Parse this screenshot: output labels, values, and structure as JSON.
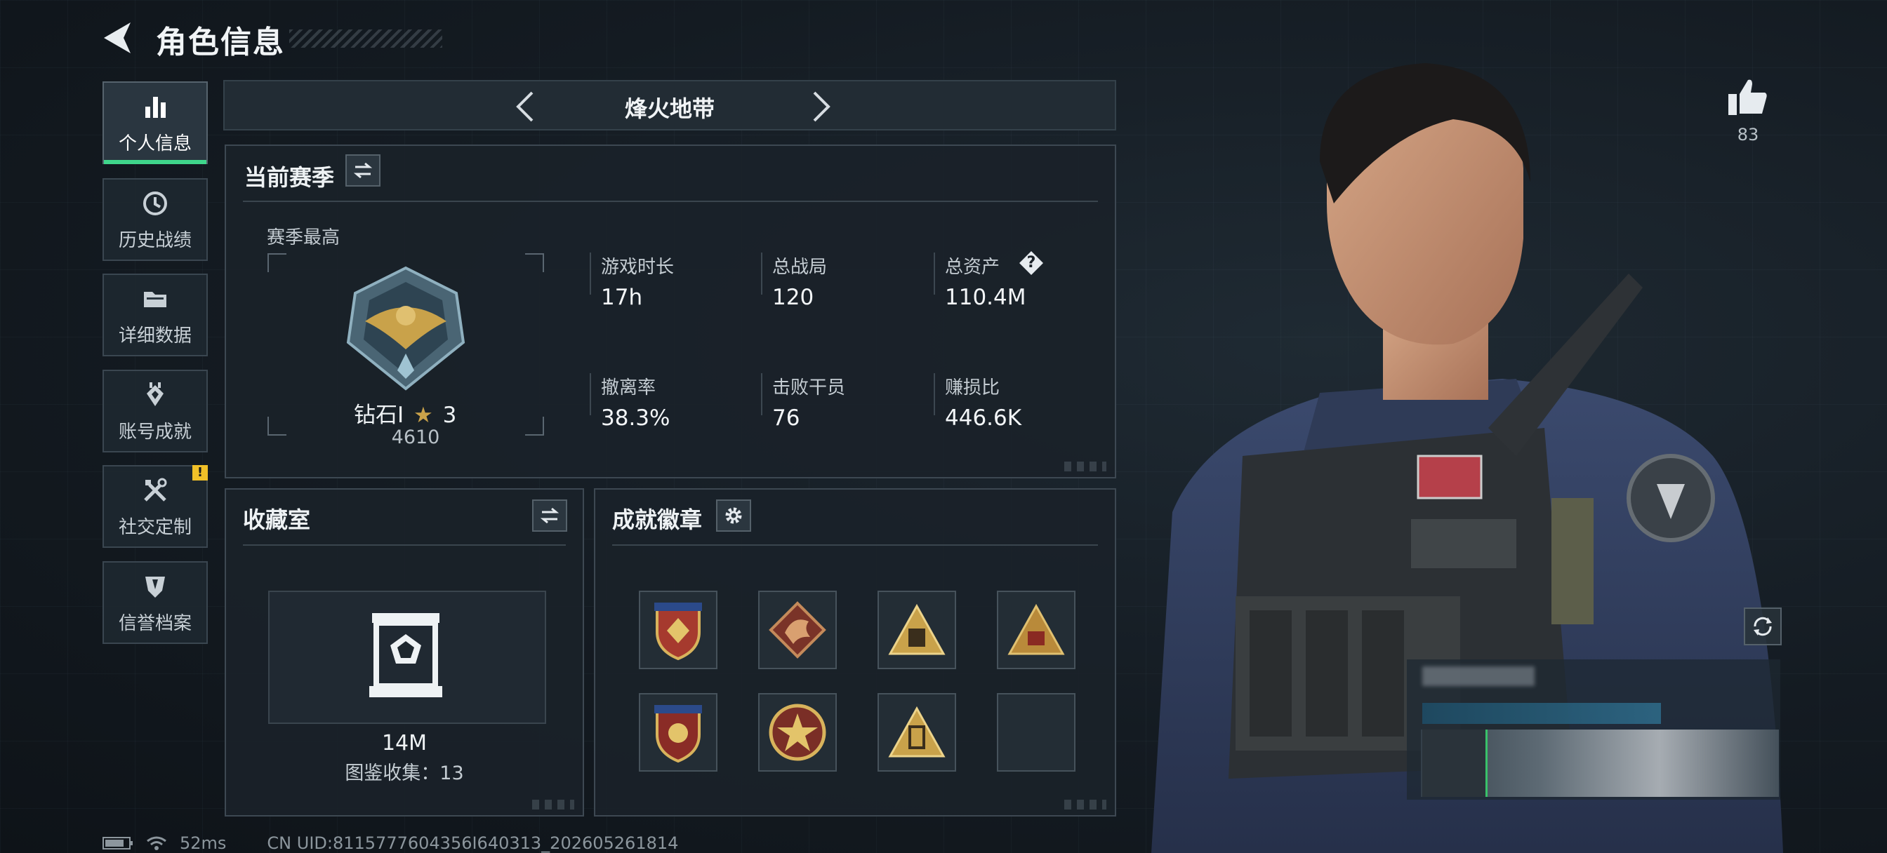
{
  "header": {
    "title": "角色信息"
  },
  "nav": {
    "items": [
      {
        "label": "个人信息",
        "icon": "bar-chart-icon",
        "active": true
      },
      {
        "label": "历史战绩",
        "icon": "history-icon"
      },
      {
        "label": "详细数据",
        "icon": "folder-icon"
      },
      {
        "label": "账号成就",
        "icon": "achievement-icon"
      },
      {
        "label": "社交定制",
        "icon": "tools-icon",
        "badge": "!"
      },
      {
        "label": "信誉档案",
        "icon": "shield-icon"
      }
    ]
  },
  "season_selector": {
    "name": "烽火地带"
  },
  "current_season": {
    "title": "当前赛季",
    "best_label": "赛季最高",
    "rank": "钻石I",
    "stars": "3",
    "score": "4610",
    "stats": [
      {
        "label": "游戏时长",
        "value": "17h"
      },
      {
        "label": "总战局",
        "value": "120"
      },
      {
        "label": "总资产",
        "value": "110.4M",
        "help": "?"
      },
      {
        "label": "撤离率",
        "value": "38.3%"
      },
      {
        "label": "击败干员",
        "value": "76"
      },
      {
        "label": "赚损比",
        "value": "446.6K"
      }
    ]
  },
  "collection": {
    "title": "收藏室",
    "value": "14M",
    "catalog_label": "图鉴收集：13"
  },
  "achievements": {
    "title": "成就徽章",
    "badges": [
      "shield-badge-icon",
      "dragon-badge-icon",
      "triangle-badge-icon",
      "triangle-badge-icon",
      "shield-badge-icon",
      "star-badge-icon",
      "triangle-badge-icon",
      "empty"
    ]
  },
  "likes": {
    "count": "83"
  },
  "status_bar": {
    "ping": "52ms",
    "uid": "CN UID:8115777604356I640313_202605261814"
  },
  "colors": {
    "accent": "#3fd58b",
    "warning": "#f0c028",
    "gold": "#c9a24a"
  }
}
